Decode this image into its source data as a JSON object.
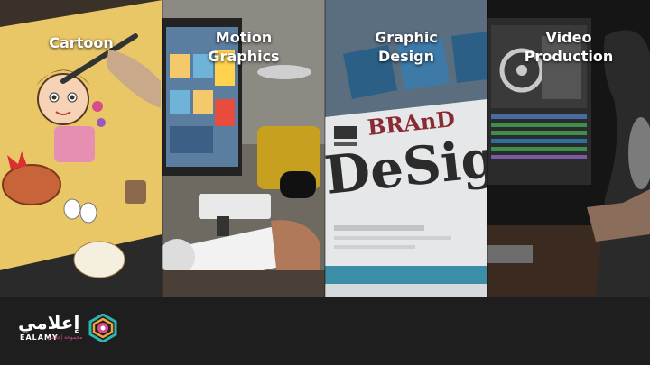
{
  "panels": [
    {
      "id": "cartoon",
      "title_lines": [
        "Cartoon"
      ]
    },
    {
      "id": "motion-graphics",
      "title_lines": [
        "Motion",
        "Graphics"
      ]
    },
    {
      "id": "graphic-design",
      "title_lines": [
        "Graphic",
        "Design"
      ],
      "art_text": [
        "BRAnD",
        "DeSig"
      ]
    },
    {
      "id": "video-production",
      "title_lines": [
        "Video",
        "Production"
      ]
    }
  ],
  "logo": {
    "arabic_name": "إعلامي",
    "english_name": "EALAMY",
    "tagline": "مجموعة إعلامي"
  },
  "colors": {
    "footer_bg": "#1e1e1e",
    "title_text": "#ffffff",
    "logo_accent_pink": "#d24b8a",
    "logo_accent_teal": "#2fb6b0",
    "logo_accent_orange": "#f2a23b"
  }
}
